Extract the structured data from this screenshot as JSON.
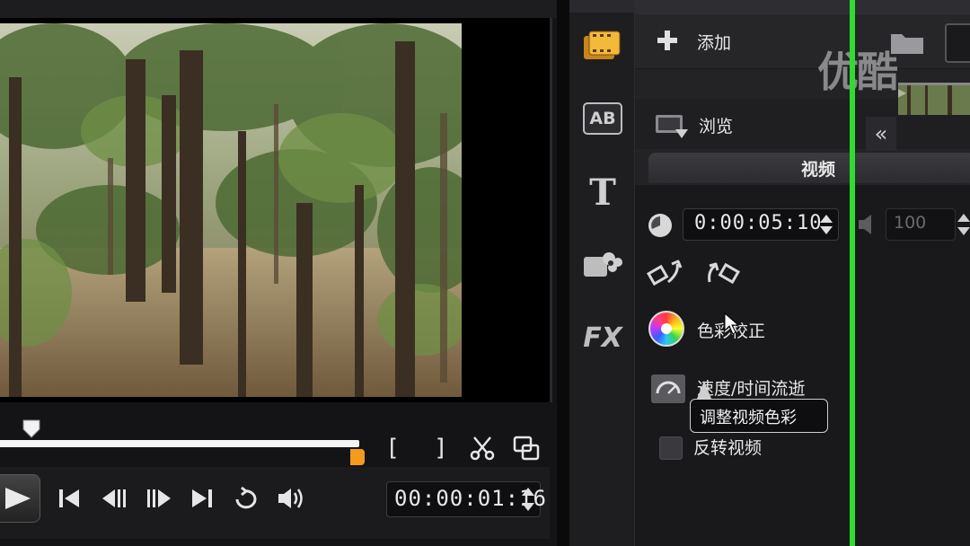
{
  "player": {
    "timecode": "00:00:01:16",
    "trim_start_label": "[",
    "trim_end_label": "]",
    "controls": {
      "play": "play-icon",
      "go_start": "skip-to-start-icon",
      "prev_frame": "previous-frame-icon",
      "next_frame": "next-frame-icon",
      "go_end": "skip-to-end-icon",
      "repeat": "repeat-icon",
      "volume": "volume-icon",
      "split": "scissors-icon",
      "enlarge": "enlarge-preview-icon"
    }
  },
  "toolbar": {
    "items": [
      {
        "name": "media",
        "icon": "film-strip-icon"
      },
      {
        "name": "transition",
        "icon": "ab-transition-icon",
        "label": "AB"
      },
      {
        "name": "title",
        "icon": "title-t-icon",
        "label": "T"
      },
      {
        "name": "graphic",
        "icon": "graphic-icon"
      },
      {
        "name": "filter",
        "icon": "fx-filter-icon",
        "label": "FX"
      }
    ]
  },
  "panel": {
    "add_label": "添加",
    "browse_label": "浏览",
    "tab_label": "视频",
    "collapse_label": "«",
    "duration": "0:00:05:10",
    "volume_value": "100",
    "color_correction_label": "色彩校正",
    "speed_label": "速度/时间流逝",
    "tooltip_text": "调整视频色彩",
    "reverse_label": "反转视频"
  },
  "watermark": {
    "text": "优酷",
    "sub": "▶"
  },
  "colors": {
    "trim_handle": "#f59a1b",
    "guide_line": "#2fdc2f",
    "panel_bg": "#232326"
  }
}
